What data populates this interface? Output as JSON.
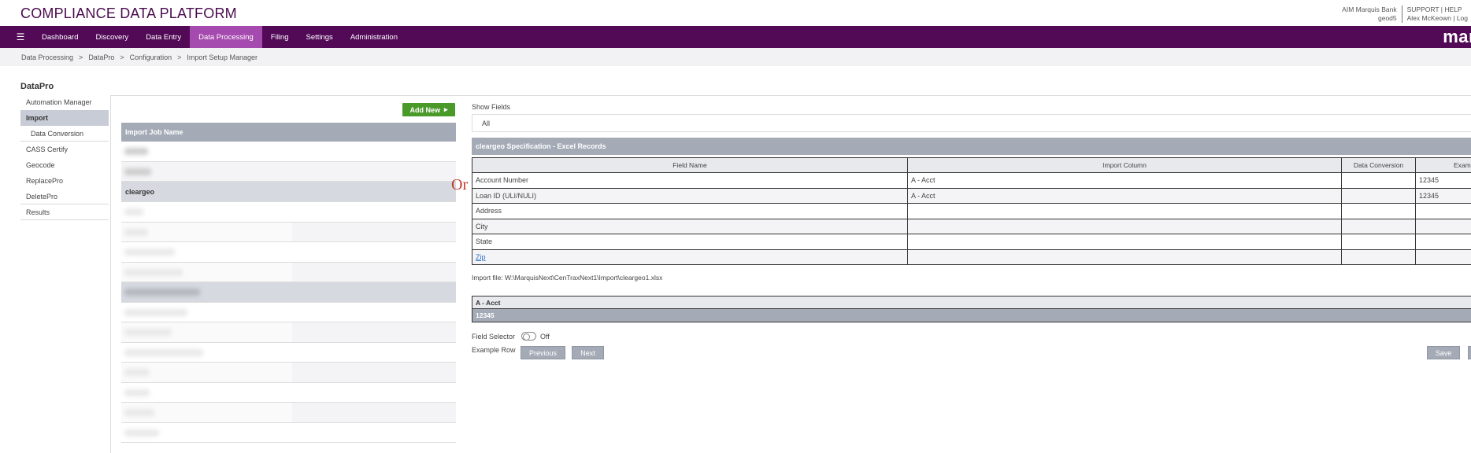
{
  "header": {
    "app_title": "COMPLIANCE DATA PLATFORM",
    "org": "AIM Marquis Bank",
    "user_id": "geod5",
    "support": "SUPPORT",
    "help": "HELP",
    "user_name": "Alex McKeown",
    "logout": "Log",
    "sep": "|"
  },
  "nav": {
    "items": [
      "Dashboard",
      "Discovery",
      "Data Entry",
      "Data Processing",
      "Filing",
      "Settings",
      "Administration"
    ],
    "active": "Data Processing",
    "brand": "marq"
  },
  "breadcrumb": [
    "Data Processing",
    "DataPro",
    "Configuration",
    "Import Setup Manager"
  ],
  "sidebar": {
    "title": "DataPro",
    "items": [
      "Automation Manager",
      "Import",
      "Data Conversion",
      "CASS Certify",
      "Geocode",
      "ReplacePro",
      "DeletePro",
      "Results"
    ]
  },
  "jobs": {
    "add_new": "Add New",
    "header": "Import Job Name",
    "group_label": "cleargeo"
  },
  "spec": {
    "show_fields_label": "Show Fields",
    "show_fields_value": "All",
    "title": "cleargeo Specification - Excel Records",
    "columns": [
      "Field Name",
      "Import Column",
      "Data Conversion",
      "Example"
    ],
    "rows": [
      {
        "field": "Account Number",
        "column": "A - Acct",
        "conversion": "",
        "example": "12345"
      },
      {
        "field": "Loan ID (ULI/NULI)",
        "column": "A - Acct",
        "conversion": "",
        "example": "12345"
      },
      {
        "field": "Address",
        "column": "",
        "conversion": "",
        "example": ""
      },
      {
        "field": "City",
        "column": "",
        "conversion": "",
        "example": ""
      },
      {
        "field": "State",
        "column": "",
        "conversion": "",
        "example": ""
      },
      {
        "field": "Zip",
        "column": "",
        "conversion": "",
        "example": ""
      }
    ],
    "import_file": "Import file: W:\\MarquisNext\\CenTraxNext1\\Import\\cleargeo1.xlsx",
    "acct_header": "A - Acct",
    "acct_value": "12345",
    "field_selector_label": "Field Selector",
    "field_selector_state": "Off",
    "example_row_label": "Example Row",
    "previous": "Previous",
    "next": "Next",
    "save": "Save"
  },
  "stray_text": "Or"
}
